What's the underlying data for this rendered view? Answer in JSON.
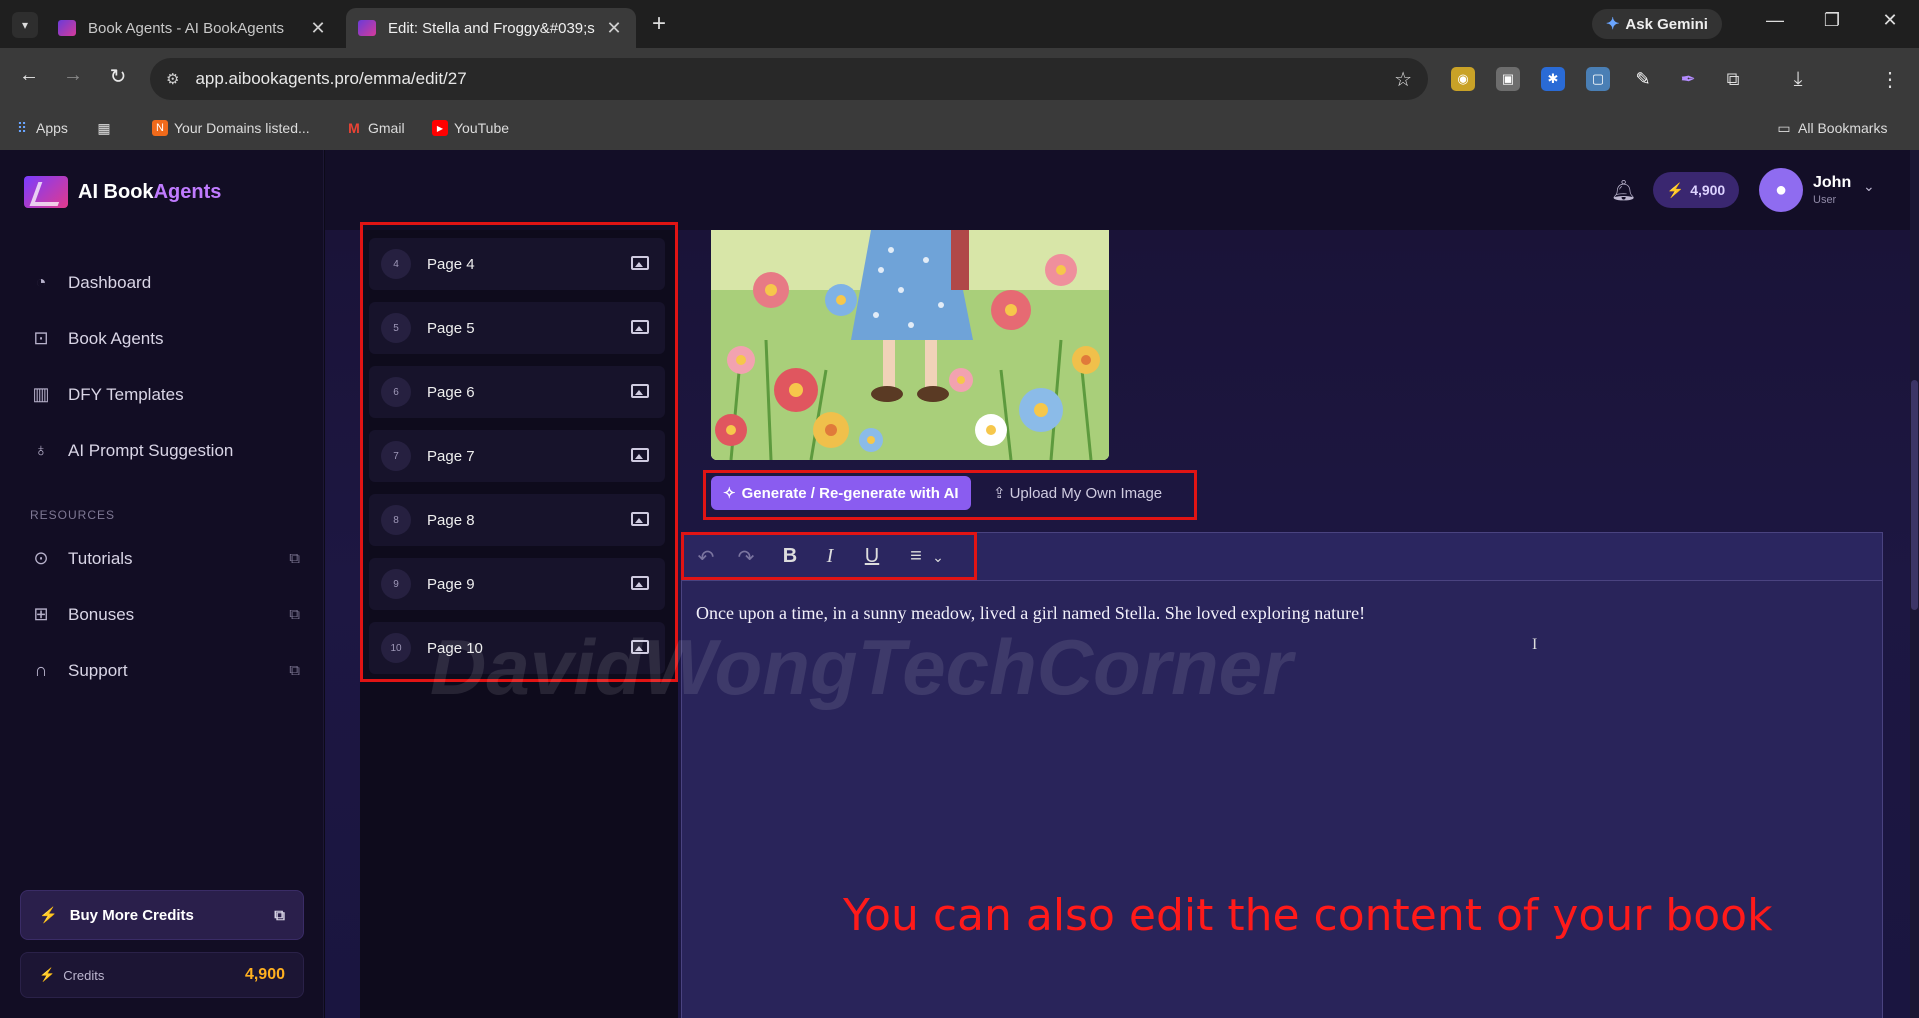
{
  "browser": {
    "tabs": [
      {
        "title": "Book Agents - AI BookAgents"
      },
      {
        "title": "Edit: Stella and Froggy&#039;s"
      }
    ],
    "ask_gemini": "Ask Gemini",
    "url": "app.aibookagents.pro/emma/edit/27",
    "bookmarks": [
      {
        "label": "Apps"
      },
      {
        "label": "Your Domains listed..."
      },
      {
        "label": "Gmail"
      },
      {
        "label": "YouTube"
      }
    ],
    "all_bookmarks": "All Bookmarks"
  },
  "sidebar": {
    "logo": {
      "part1": "AI Book",
      "part2": "Agents"
    },
    "nav": [
      {
        "label": "Dashboard",
        "icon": "gauge-icon"
      },
      {
        "label": "Book Agents",
        "icon": "robot-icon"
      },
      {
        "label": "DFY Templates",
        "icon": "layout-icon"
      },
      {
        "label": "AI Prompt Suggestion",
        "icon": "lightbulb-icon"
      }
    ],
    "resources_label": "RESOURCES",
    "resources": [
      {
        "label": "Tutorials",
        "icon": "play-circle-icon"
      },
      {
        "label": "Bonuses",
        "icon": "gift-icon"
      },
      {
        "label": "Support",
        "icon": "headset-icon"
      }
    ],
    "buy_credits": "Buy More Credits",
    "credits_label": "Credits",
    "credits_value": "4,900"
  },
  "header": {
    "credits": "4,900",
    "user_name": "John",
    "user_role": "User"
  },
  "pages": [
    {
      "num": "4",
      "label": "Page 4"
    },
    {
      "num": "5",
      "label": "Page 5"
    },
    {
      "num": "6",
      "label": "Page 6"
    },
    {
      "num": "7",
      "label": "Page 7"
    },
    {
      "num": "8",
      "label": "Page 8"
    },
    {
      "num": "9",
      "label": "Page 9"
    },
    {
      "num": "10",
      "label": "Page 10"
    }
  ],
  "image_actions": {
    "generate": "Generate / Re-generate with AI",
    "upload": "Upload My Own Image"
  },
  "editor": {
    "text": "Once upon a time, in a sunny meadow, lived a girl named Stella. She loved exploring nature!"
  },
  "overlay_caption": "You can also edit the content of your book",
  "watermark": "DavidWongTechCorner",
  "colors": {
    "accent": "#8a5cf0",
    "annotation": "#e11414",
    "credit": "#ffb020"
  }
}
